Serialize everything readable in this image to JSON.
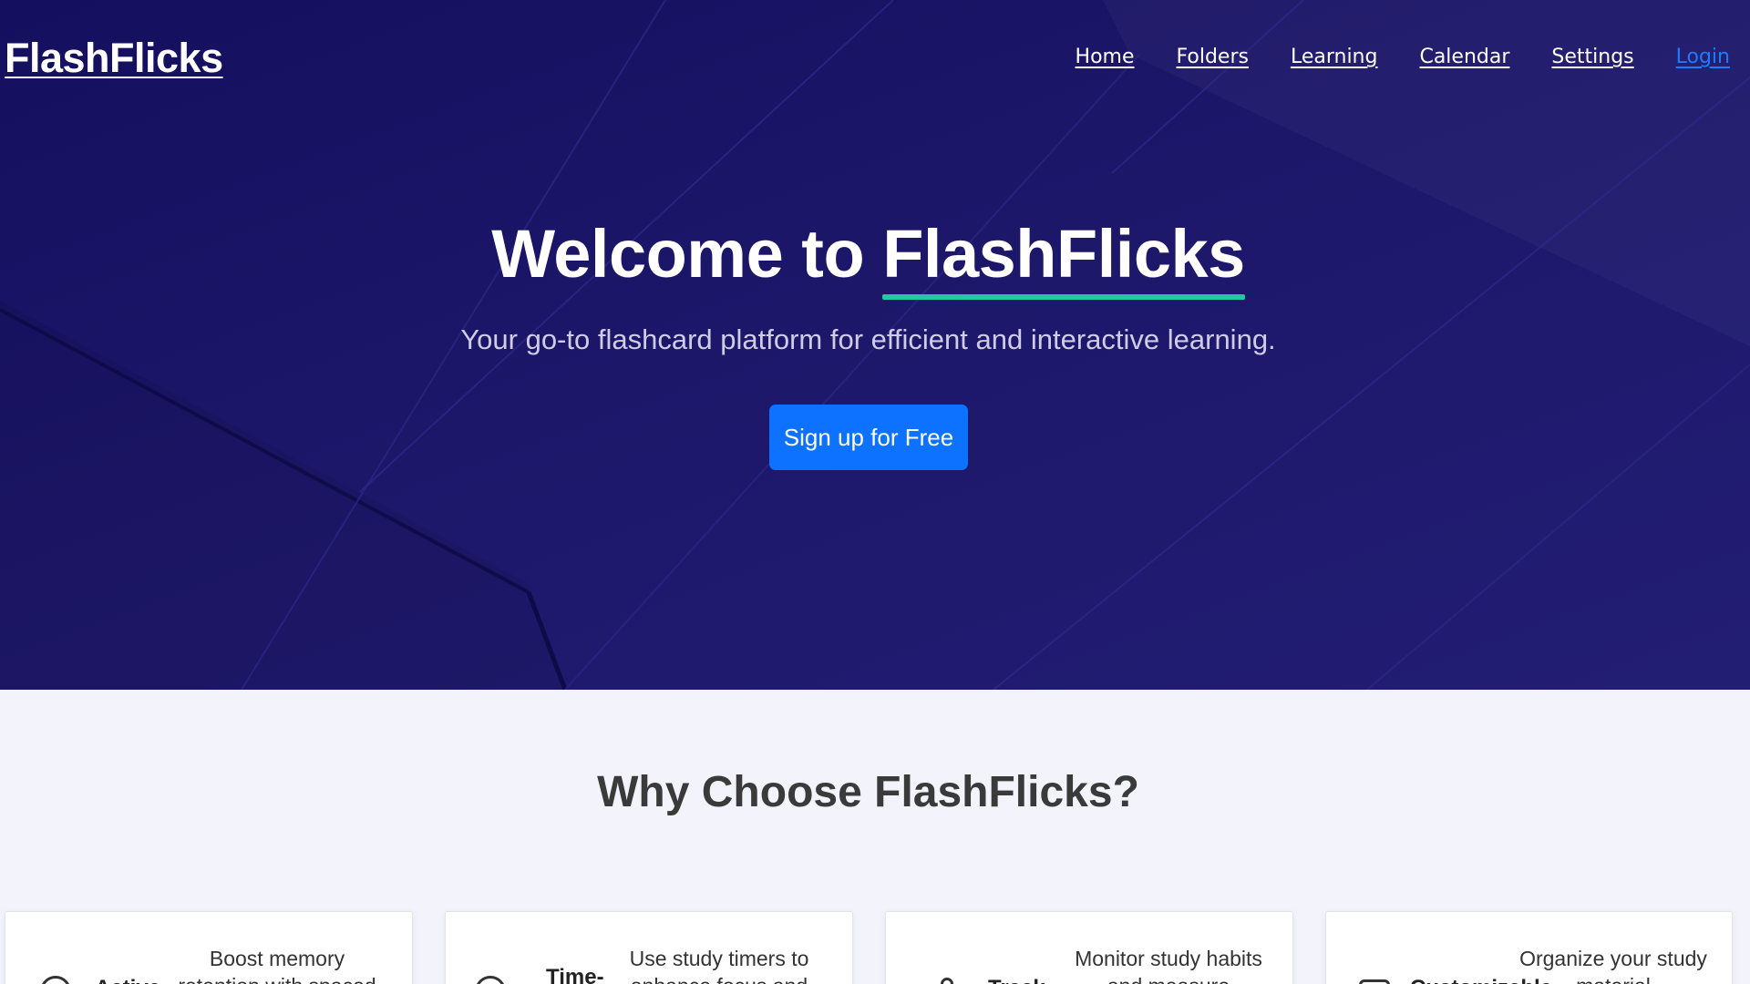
{
  "header": {
    "logo": "FlashFlicks",
    "nav": [
      "Home",
      "Folders",
      "Learning",
      "Calendar",
      "Settings"
    ],
    "login": "Login"
  },
  "hero": {
    "title_prefix": "Welcome to",
    "title_brand": "FlashFlicks",
    "subtitle": "Your go-to flashcard platform for efficient and interactive learning.",
    "cta": "Sign up for Free"
  },
  "features": {
    "title": "Why Choose FlashFlicks?",
    "cards": [
      {
        "title": "Active",
        "description": "Boost memory retention with spaced",
        "icon": "circle-icon"
      },
      {
        "title": "Time-",
        "description": "Use study timers to enhance focus and",
        "icon": "clock-icon"
      },
      {
        "title": "Track",
        "description": "Monitor study habits and measure",
        "icon": "user-icon"
      },
      {
        "title": "Customizable",
        "description": "Organize your study material",
        "icon": "folder-icon"
      }
    ]
  },
  "colors": {
    "hero_bg": "#1d176a",
    "accent": "#0d72ff",
    "underline": "#1fc9a3",
    "page_bg": "#f3f3fb"
  }
}
